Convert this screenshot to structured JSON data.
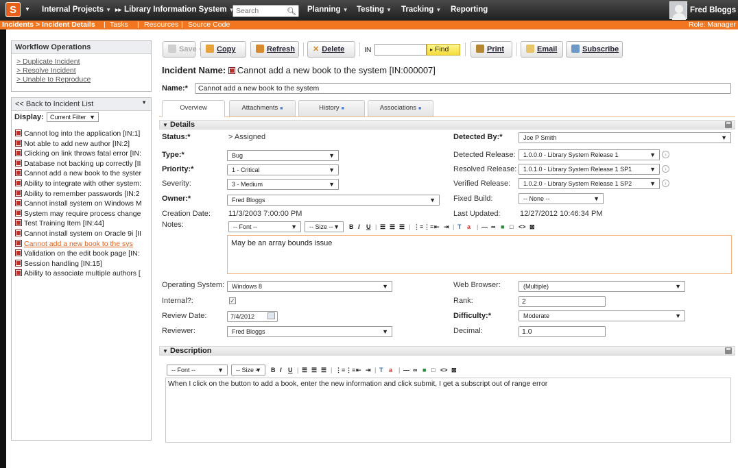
{
  "topbar": {
    "logo": "S",
    "menu": {
      "projects": "Internal Projects",
      "system": "Library Information System",
      "planning": "Planning",
      "testing": "Testing",
      "tracking": "Tracking",
      "reporting": "Reporting"
    },
    "search_placeholder": "Search",
    "user_name": "Fred Bloggs"
  },
  "subbar": {
    "breadcrumb": "Incidents > Incident Details",
    "links": [
      "Tasks",
      "Resources",
      "Source Code"
    ],
    "role": "Role: Manager"
  },
  "sidebar": {
    "workflow_title": "Workflow Operations",
    "workflow_items": [
      "> Duplicate Incident",
      "> Resolve Incident",
      "> Unable to Reproduce"
    ],
    "back_link": "<< Back to Incident List",
    "display_label": "Display:",
    "display_value": "Current Filter",
    "incidents": [
      {
        "label": "Cannot log into the application [IN:1]",
        "active": false
      },
      {
        "label": "Not able to add new author [IN:2]",
        "active": false
      },
      {
        "label": "Clicking on link throws fatal error [IN:",
        "active": false
      },
      {
        "label": "Database not backing up correctly [II",
        "active": false
      },
      {
        "label": "Cannot add a new book to the syster",
        "active": false
      },
      {
        "label": "Ability to integrate with other system:",
        "active": false
      },
      {
        "label": "Ability to remember passwords [IN:2",
        "active": false
      },
      {
        "label": "Cannot install system on Windows M",
        "active": false
      },
      {
        "label": "System may require process change",
        "active": false
      },
      {
        "label": "Test Training Item [IN:44]",
        "active": false
      },
      {
        "label": "Cannot install system on Oracle 9i [II",
        "active": false
      },
      {
        "label": "Cannot add a new book to the sys",
        "active": true
      },
      {
        "label": "Validation on the edit book page [IN:",
        "active": false
      },
      {
        "label": "Session handling [IN:15]",
        "active": false
      },
      {
        "label": "Ability to associate multiple authors [",
        "active": false
      }
    ]
  },
  "toolbar": {
    "save": "Save",
    "copy": "Copy",
    "refresh": "Refresh",
    "delete": "Delete",
    "in_prefix": "IN",
    "find": "Find",
    "print": "Print",
    "email": "Email",
    "subscribe": "Subscribe"
  },
  "incident": {
    "name_label": "Incident Name:",
    "name_heading": "Cannot add a new book to the system [IN:000007]",
    "name_field_label": "Name:*",
    "name_value": "Cannot add a new book to the system"
  },
  "tabs": [
    "Overview",
    "Attachments",
    "History",
    "Associations"
  ],
  "details": {
    "section_title": "Details",
    "status_label": "Status:*",
    "status_value": "> Assigned",
    "type_label": "Type:*",
    "type_value": "Bug",
    "priority_label": "Priority:*",
    "priority_value": "1 - Critical",
    "severity_label": "Severity:",
    "severity_value": "3 - Medium",
    "owner_label": "Owner:*",
    "owner_value": "Fred Bloggs",
    "creation_label": "Creation Date:",
    "creation_value": "11/3/2003 7:00:00 PM",
    "notes_label": "Notes:",
    "detected_by_label": "Detected By:*",
    "detected_by_value": "Joe P Smith",
    "detected_release_label": "Detected Release:",
    "detected_release_value": "1.0.0.0 - Library System Release 1",
    "resolved_release_label": "Resolved Release:",
    "resolved_release_value": "1.0.1.0 - Library System Release 1 SP1",
    "verified_release_label": "Verified Release:",
    "verified_release_value": "1.0.2.0 - Library System Release 1 SP2",
    "fixed_build_label": "Fixed Build:",
    "fixed_build_value": "-- None --",
    "last_updated_label": "Last Updated:",
    "last_updated_value": "12/27/2012 10:46:34 PM",
    "notes_text": "May be an array bounds issue",
    "os_label": "Operating System:",
    "os_value": "Windows 8",
    "internal_label": "Internal?:",
    "review_date_label": "Review Date:",
    "review_date_value": "7/4/2012",
    "reviewer_label": "Reviewer:",
    "reviewer_value": "Fred Bloggs",
    "browser_label": "Web Browser:",
    "browser_value": "(Multiple)",
    "rank_label": "Rank:",
    "rank_value": "2",
    "difficulty_label": "Difficulty:*",
    "difficulty_value": "Moderate",
    "decimal_label": "Decimal:",
    "decimal_value": "1.0"
  },
  "editor": {
    "font": "-- Font --",
    "size": "-- Size --"
  },
  "description": {
    "section_title": "Description",
    "text": "When I click on the button to add a book, enter the new information and click submit, I get a subscript out of range error"
  }
}
